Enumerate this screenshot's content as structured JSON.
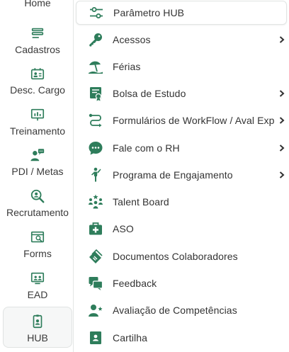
{
  "accent_color": "#2e7d5b",
  "rail": {
    "items": [
      {
        "label": "Home",
        "icon": "home-icon"
      },
      {
        "label": "Cadastros",
        "icon": "list-icon"
      },
      {
        "label": "Desc. Cargo",
        "icon": "id-card-icon"
      },
      {
        "label": "Treinamento",
        "icon": "presentation-icon"
      },
      {
        "label": "PDI / Metas",
        "icon": "person-chat-icon"
      },
      {
        "label": "Recrutamento",
        "icon": "search-person-icon"
      },
      {
        "label": "Forms",
        "icon": "form-icon"
      },
      {
        "label": "EAD",
        "icon": "screen-icon"
      },
      {
        "label": "HUB",
        "icon": "badge-icon",
        "active": true
      }
    ]
  },
  "submenu": {
    "items": [
      {
        "label": "Parâmetro HUB",
        "icon": "sliders-icon",
        "has_children": false,
        "selected": true
      },
      {
        "label": "Acessos",
        "icon": "key-icon",
        "has_children": true
      },
      {
        "label": "Férias",
        "icon": "beach-icon",
        "has_children": false
      },
      {
        "label": "Bolsa de Estudo",
        "icon": "scholarship-icon",
        "has_children": true
      },
      {
        "label": "Formulários de WorkFlow / Aval Exp",
        "icon": "workflow-icon",
        "has_children": true
      },
      {
        "label": "Fale com o RH",
        "icon": "chat-icon",
        "has_children": true
      },
      {
        "label": "Programa de Engajamento",
        "icon": "engagement-icon",
        "has_children": true
      },
      {
        "label": "Talent Board",
        "icon": "talent-icon",
        "has_children": false
      },
      {
        "label": "ASO",
        "icon": "medical-kit-icon",
        "has_children": false
      },
      {
        "label": "Documentos Colaboradores",
        "icon": "documents-icon",
        "has_children": false
      },
      {
        "label": "Feedback",
        "icon": "feedback-icon",
        "has_children": false
      },
      {
        "label": "Avaliação de Competências",
        "icon": "person-star-icon",
        "has_children": false
      },
      {
        "label": "Cartilha",
        "icon": "booklet-icon",
        "has_children": false
      }
    ]
  }
}
